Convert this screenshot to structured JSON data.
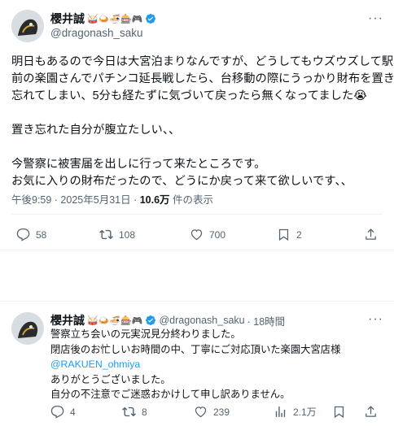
{
  "tweet1": {
    "name": "櫻井誠",
    "name_emojis": "🥁🍛🍜🎰🎮",
    "handle": "@dragonash_saku",
    "lines": [
      "明日もあるので今日は大宮泊まりなんですが、どうしてもウズウズして駅",
      "前の楽園さんでパチンコ延長戦したら、台移動の際にうっかり財布を置き",
      "忘れてしまい、5分も経たずに気づいて戻ったら無くなってました😭",
      "",
      "置き忘れた自分が腹立たしい、、",
      "",
      "今警察に被害届を出しに行って来たところです。",
      "お気に入りの財布だったので、どうにか戻って来て欲しいです、、"
    ],
    "time": "午後9:59 · 2025年5月31日 · ",
    "views": "10.6万",
    "views_suffix": " 件の表示",
    "stats": {
      "replies": "58",
      "reposts": "108",
      "likes": "700",
      "bookmarks": "2"
    }
  },
  "tweet2": {
    "name": "櫻井誠",
    "name_emojis": "🥁🍛🍜🎰🎮",
    "handle": "@dragonash_saku",
    "time_ago": "· 18時間",
    "lines": [
      "警察立ち会いの元実況見分終わりました。",
      "閉店後のお忙しいお時間の中、丁寧にご対応頂いた楽園大宮店様",
      "@RAKUEN_ohmiya",
      "ありがとうございました。",
      "自分の不注意でご迷惑おかけして申し訳ありません。"
    ],
    "stats": {
      "replies": "4",
      "reposts": "8",
      "likes": "239",
      "views": "2.1万"
    }
  },
  "colors": {
    "accent": "#1d9bf0",
    "muted": "#536471",
    "text": "#0f1419"
  }
}
